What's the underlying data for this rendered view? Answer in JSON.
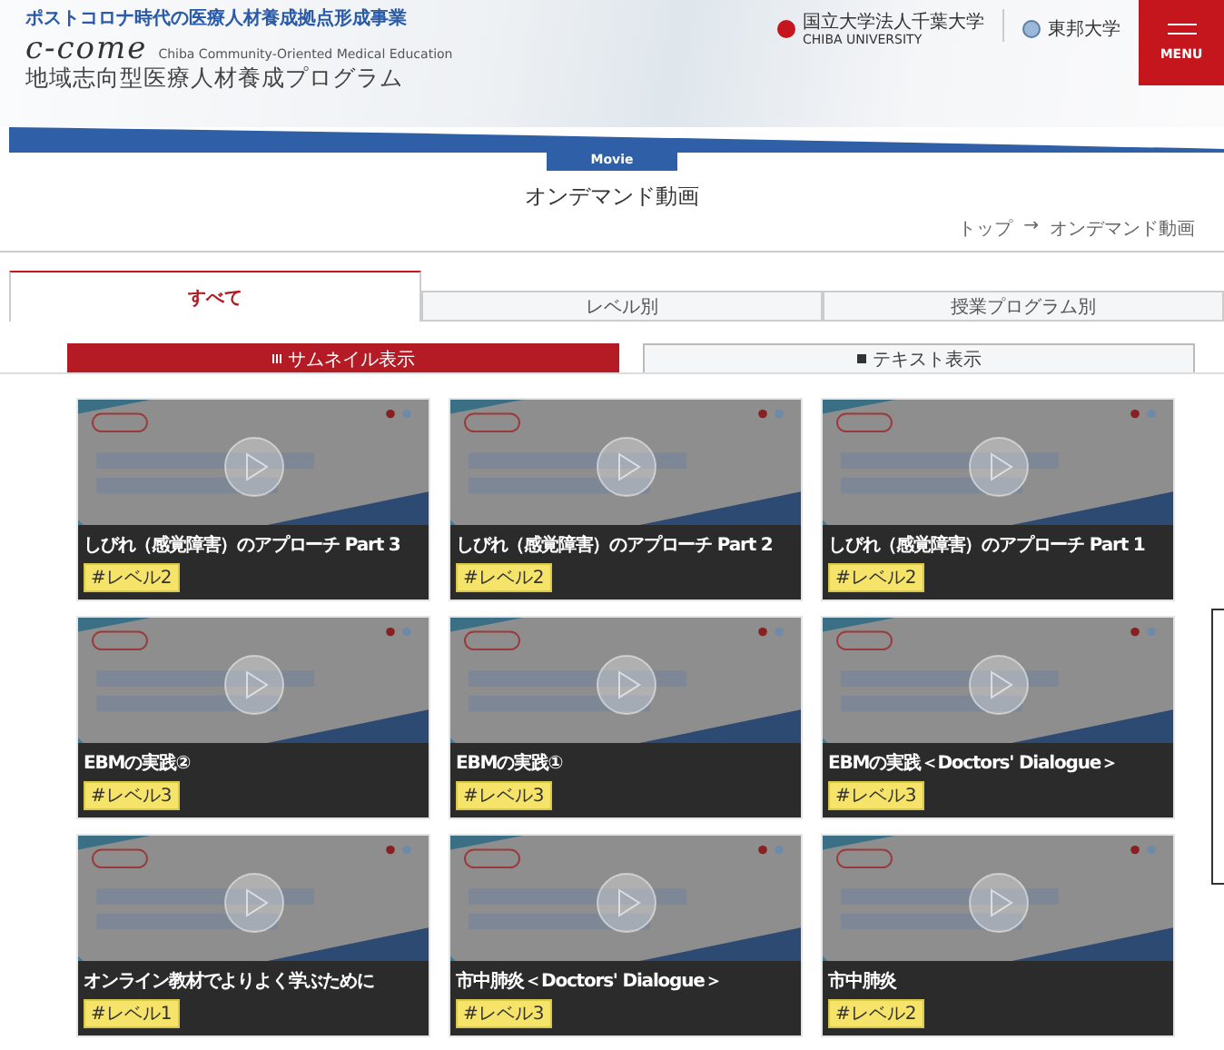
{
  "header": {
    "project": "ポストコロナ時代の医療人材養成拠点形成事業",
    "logo": "c-come",
    "logo_sub": "Chiba Community-Oriented Medical Education",
    "program": "地域志向型医療人材養成プログラム",
    "partners": [
      {
        "kind": "chiba",
        "line1": "国立大学法人千葉大学",
        "line2": "CHIBA UNIVERSITY"
      },
      {
        "kind": "toho",
        "line1": "東邦大学"
      }
    ],
    "menu": "MENU"
  },
  "section_label": "Movie",
  "page_title": "オンデマンド動画",
  "breadcrumb": [
    "トップ",
    "→",
    "オンデマンド動画"
  ],
  "tabs": [
    {
      "label": "すべて",
      "selected": true
    },
    {
      "label": "レベル別",
      "selected": false
    },
    {
      "label": "授業プログラム別",
      "selected": false
    }
  ],
  "views": [
    {
      "kind": "grid",
      "label": "サムネイル表示",
      "selected": true
    },
    {
      "kind": "list",
      "label": "テキスト表示",
      "selected": false
    }
  ],
  "videos": [
    {
      "title": "しびれ（感覚障害）のアプローチ Part 3",
      "tags": [
        {
          "label": "#レベル2",
          "kind": "level"
        }
      ]
    },
    {
      "title": "しびれ（感覚障害）のアプローチ Part 2",
      "tags": [
        {
          "label": "#レベル2",
          "kind": "level"
        }
      ]
    },
    {
      "title": "しびれ（感覚障害）のアプローチ Part 1",
      "tags": [
        {
          "label": "#レベル2",
          "kind": "level"
        }
      ]
    },
    {
      "title": "EBMの実践②",
      "tags": [
        {
          "label": "#レベル3",
          "kind": "level"
        }
      ]
    },
    {
      "title": "EBMの実践①",
      "tags": [
        {
          "label": "#レベル3",
          "kind": "level"
        }
      ]
    },
    {
      "title": "EBMの実践＜Doctors' Dialogue＞",
      "tags": [
        {
          "label": "#レベル3",
          "kind": "level"
        }
      ]
    },
    {
      "title": "オンライン教材でよりよく学ぶために",
      "tags": [
        {
          "label": "#レベル1",
          "kind": "level"
        }
      ]
    },
    {
      "title": "市中肺炎＜Doctors' Dialogue＞",
      "tags": [
        {
          "label": "#レベル3",
          "kind": "level"
        }
      ]
    },
    {
      "title": "市中肺炎",
      "tags": [
        {
          "label": "#レベル2",
          "kind": "level"
        }
      ]
    }
  ]
}
